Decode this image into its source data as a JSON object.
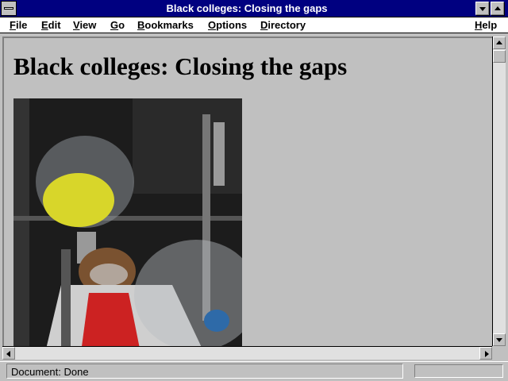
{
  "window": {
    "title": "Black colleges: Closing the gaps"
  },
  "menu": {
    "file": "File",
    "edit": "Edit",
    "view": "View",
    "go": "Go",
    "bookmarks": "Bookmarks",
    "options": "Options",
    "directory": "Directory",
    "help": "Help"
  },
  "page": {
    "heading": "Black colleges: Closing the gaps"
  },
  "status": {
    "text": "Document: Done",
    "progress": 0
  },
  "colors": {
    "titlebar": "#000080",
    "chrome": "#c0c0c0",
    "menubar": "#ffffff"
  },
  "icons": [
    "system-menu-icon",
    "minimize-arrow-icon",
    "maximize-arrow-icon",
    "scroll-up-icon",
    "scroll-down-icon",
    "scroll-left-icon",
    "scroll-right-icon"
  ]
}
